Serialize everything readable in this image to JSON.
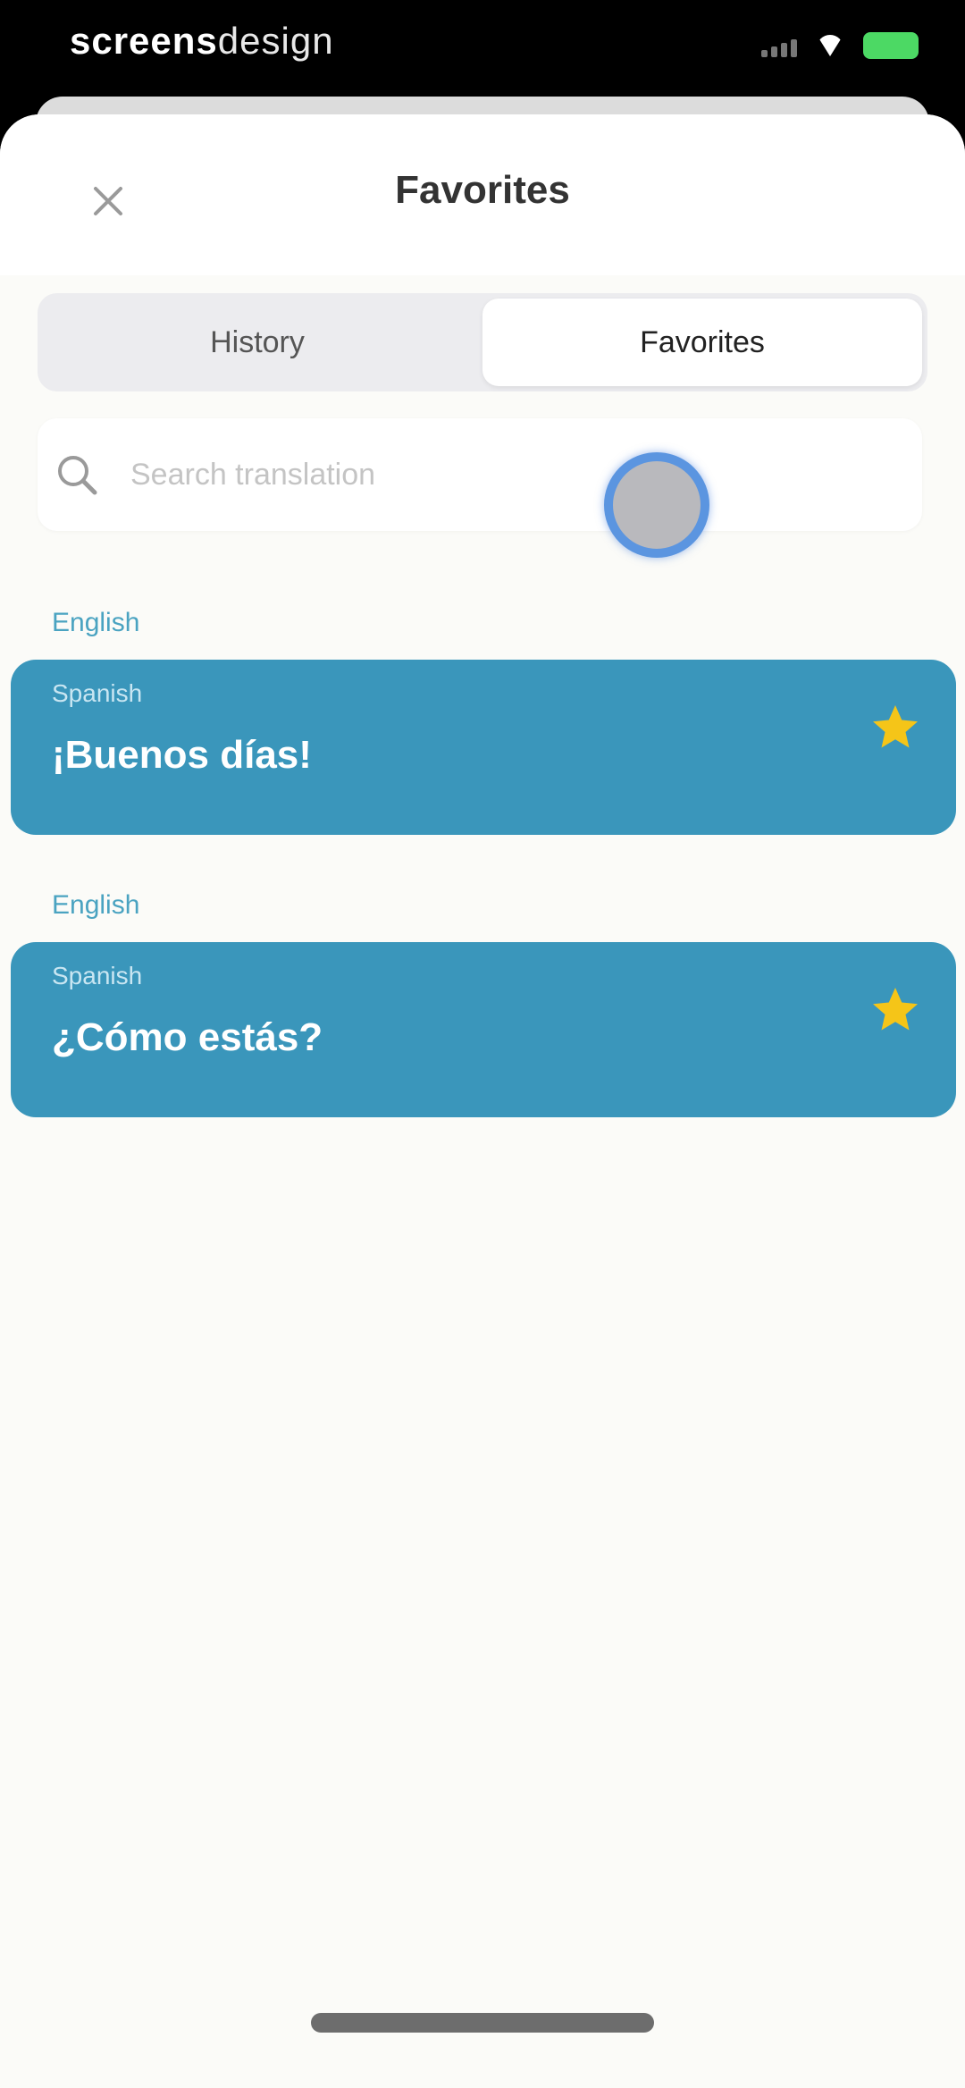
{
  "status": {
    "brand_bold": "screens",
    "brand_light": "design"
  },
  "header": {
    "title": "Favorites"
  },
  "tabs": [
    {
      "label": "History",
      "active": false
    },
    {
      "label": "Favorites",
      "active": true
    }
  ],
  "search": {
    "placeholder": "Search translation",
    "value": ""
  },
  "favorites": [
    {
      "source_language": "English",
      "target_language": "Spanish",
      "text": "¡Buenos días!",
      "starred": true
    },
    {
      "source_language": "English",
      "target_language": "Spanish",
      "text": "¿Cómo estás?",
      "starred": true
    }
  ],
  "colors": {
    "card": "#3a96bb",
    "accent_label": "#4aa3c1",
    "star": "#f5c518"
  }
}
